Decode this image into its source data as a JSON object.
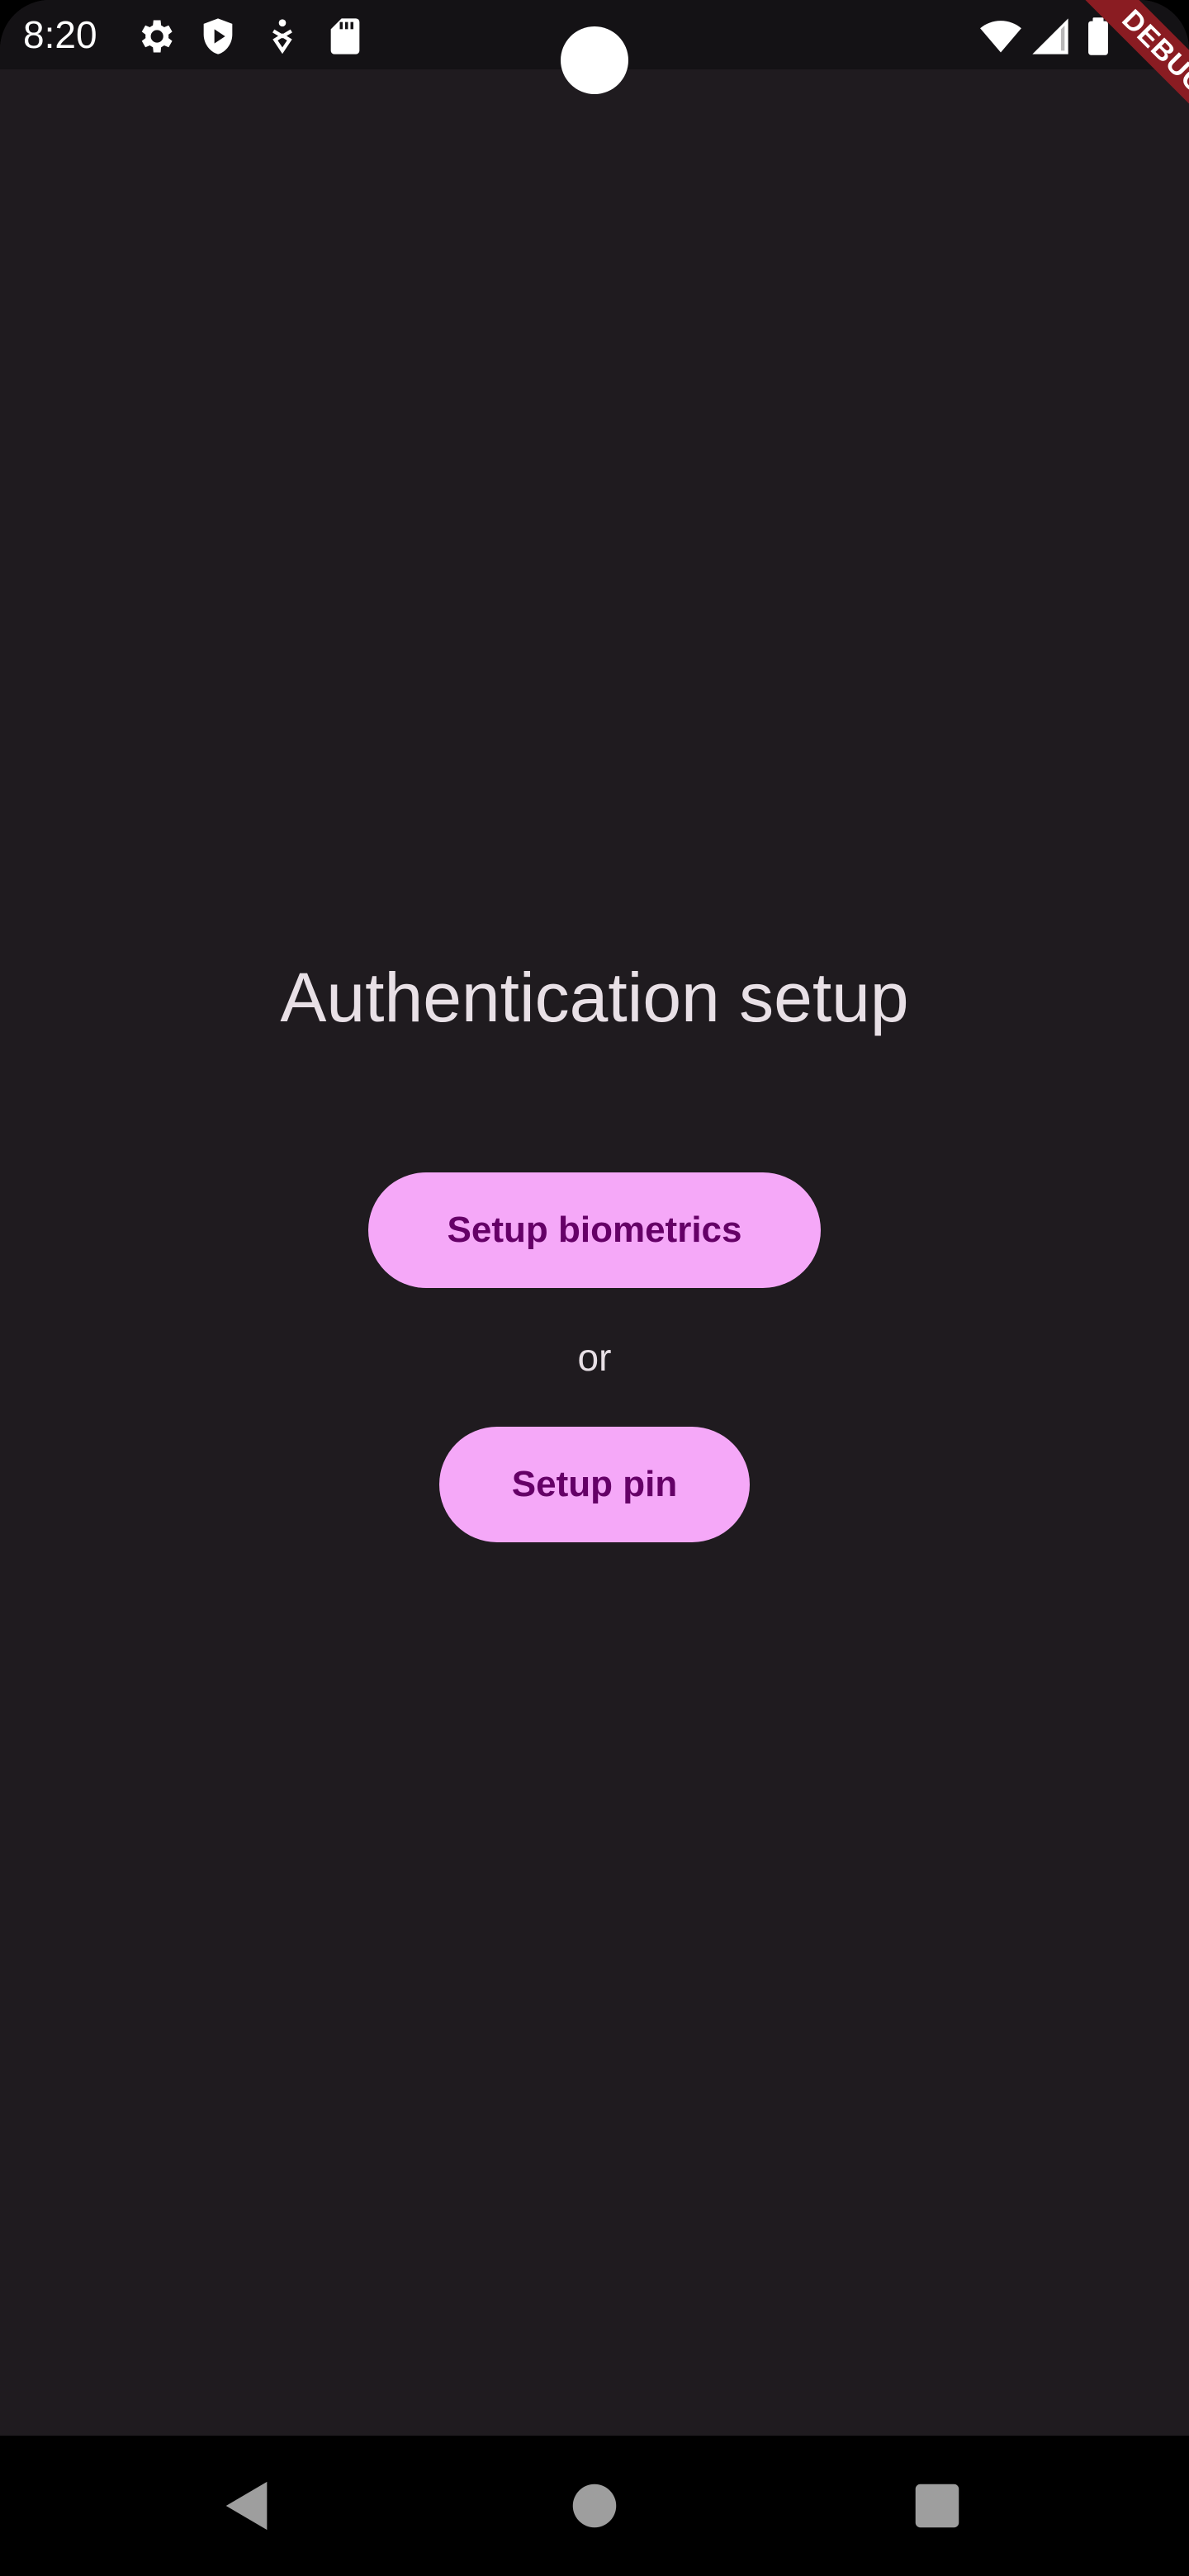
{
  "status_bar": {
    "time": "8:20",
    "icons": [
      "settings-icon",
      "play-protect-icon",
      "accessibility-icon",
      "sd-card-icon",
      "wifi-icon",
      "signal-icon",
      "battery-icon"
    ]
  },
  "debug_banner": {
    "label": "DEBUG"
  },
  "main": {
    "title": "Authentication setup",
    "biometrics_button_label": "Setup biometrics",
    "separator_text": "or",
    "pin_button_label": "Setup pin"
  },
  "nav_bar": {
    "icons": [
      "back-icon",
      "home-icon",
      "recents-icon"
    ]
  },
  "colors": {
    "background": "#1f1b1f",
    "button_fill": "#f5a8f8",
    "button_text": "#650067",
    "text": "#e8e0e6",
    "debug_ribbon": "#8a1c22"
  }
}
